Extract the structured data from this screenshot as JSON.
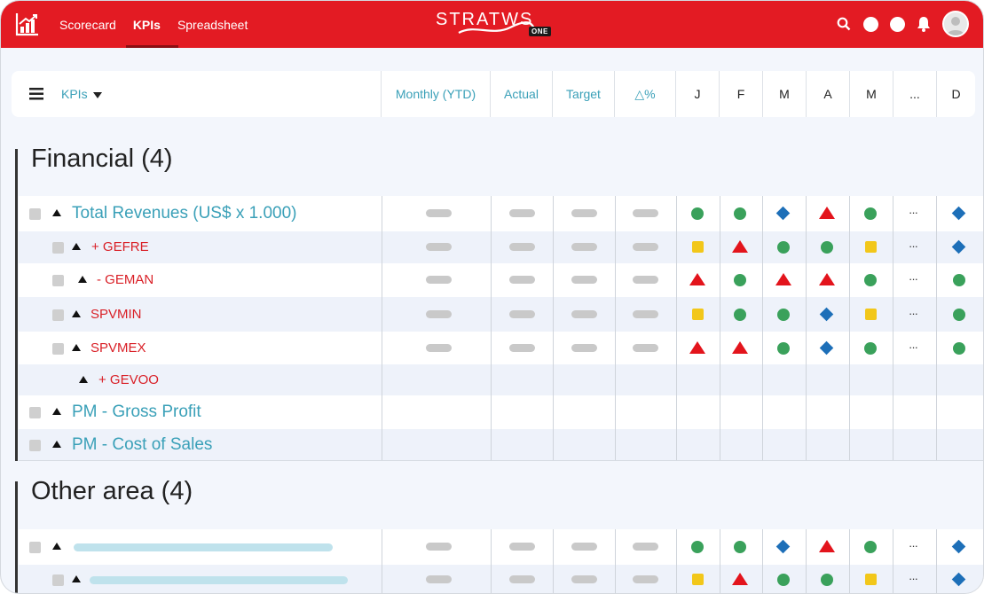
{
  "nav": {
    "items": [
      "Scorecard",
      "KPIs",
      "Spreadsheet"
    ],
    "active": "KPIs",
    "brand": "STRATWS",
    "brand_badge": "ONE"
  },
  "header": {
    "kpi_select": "KPIs",
    "columns": [
      "Monthly (YTD)",
      "Actual",
      "Target",
      "△%"
    ],
    "months": [
      "J",
      "F",
      "M",
      "A",
      "M",
      "...",
      "D"
    ]
  },
  "sections": [
    {
      "title": "Financial (4)",
      "rows": [
        {
          "name": "Total Revenues (US$ x 1.000)",
          "level": "main",
          "checkbox": true,
          "values": true,
          "indicators": [
            "circle",
            "circle",
            "diamond",
            "triangle",
            "circle",
            "dots",
            "diamond"
          ]
        },
        {
          "name": "+ GEFRE",
          "level": "sub",
          "checkbox": true,
          "values": true,
          "indicators": [
            "square",
            "triangle",
            "circle",
            "circle",
            "square",
            "dots",
            "diamond"
          ]
        },
        {
          "name": "- GEMAN",
          "level": "sub",
          "checkbox": true,
          "values": true,
          "indicators": [
            "triangle",
            "circle",
            "triangle",
            "triangle",
            "circle",
            "dots",
            "circle"
          ]
        },
        {
          "name": "SPVMIN",
          "level": "sub2",
          "checkbox": true,
          "values": true,
          "indicators": [
            "square",
            "circle",
            "circle",
            "diamond",
            "square",
            "dots",
            "circle"
          ]
        },
        {
          "name": "SPVMEX",
          "level": "sub2",
          "checkbox": true,
          "values": true,
          "indicators": [
            "triangle",
            "triangle",
            "circle",
            "diamond",
            "circle",
            "dots",
            "circle"
          ]
        },
        {
          "name": "+ GEVOO",
          "level": "sub3",
          "checkbox": false,
          "values": false,
          "indicators": []
        },
        {
          "name": "PM - Gross Profit",
          "level": "main",
          "checkbox": true,
          "values": false,
          "indicators": []
        },
        {
          "name": "PM - Cost of Sales",
          "level": "main",
          "checkbox": true,
          "values": false,
          "indicators": []
        }
      ]
    },
    {
      "title": "Other area (4)",
      "rows": [
        {
          "name": "",
          "level": "main",
          "checkbox": true,
          "values": true,
          "indicators": [
            "circle",
            "circle",
            "diamond",
            "triangle",
            "circle",
            "dots",
            "diamond"
          ]
        },
        {
          "name": "",
          "level": "sub",
          "checkbox": true,
          "values": true,
          "indicators": [
            "square",
            "triangle",
            "circle",
            "circle",
            "square",
            "dots",
            "diamond"
          ]
        }
      ]
    }
  ],
  "colors": {
    "brand_red": "#e31b23",
    "accent_teal": "#3aa0b8",
    "status_green": "#3aa15b",
    "status_yellow": "#f2c71a",
    "status_blue": "#1d6fb8",
    "status_red": "#e3141c"
  },
  "icons": {
    "logo": "bar-chart-logo-icon",
    "search": "search-icon",
    "bell": "bell-icon",
    "menu": "hamburger-menu-icon"
  }
}
